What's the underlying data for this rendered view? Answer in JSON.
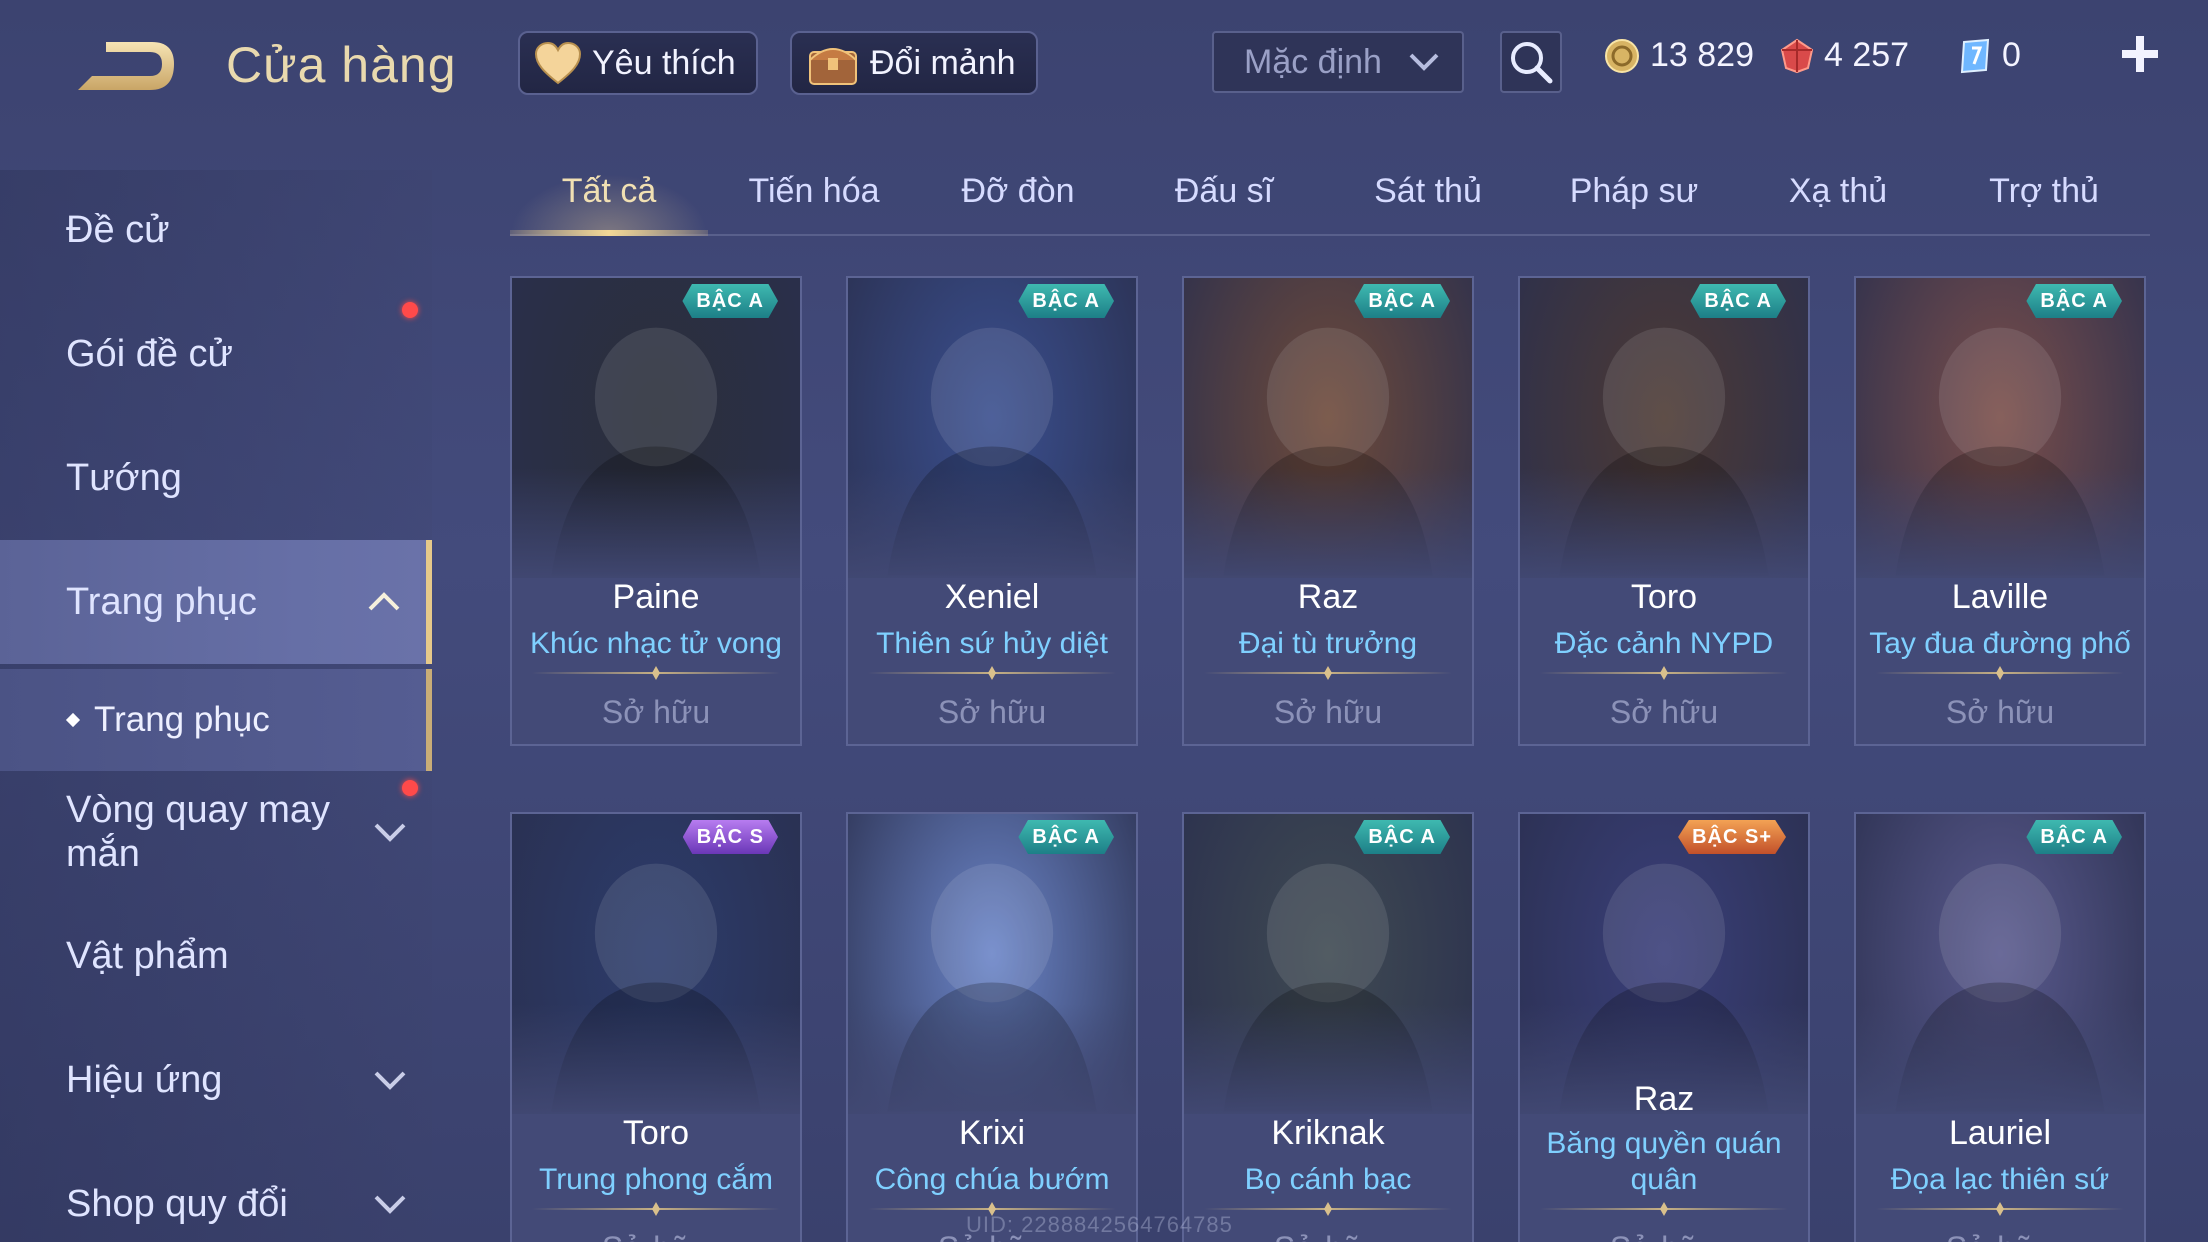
{
  "header": {
    "title": "Cửa hàng",
    "favorite_label": "Yêu thích",
    "exchange_label": "Đổi mảnh",
    "sort_value": "Mặc định"
  },
  "currencies": {
    "gold": "13 829",
    "ruby": "4 257",
    "voucher": "0"
  },
  "sidebar": {
    "items": [
      {
        "label": "Đề cử"
      },
      {
        "label": "Gói đề cử"
      },
      {
        "label": "Tướng"
      },
      {
        "label": "Trang phục"
      },
      {
        "label": "Trang phục"
      },
      {
        "label": "Vòng quay may mắn"
      },
      {
        "label": "Vật phẩm"
      },
      {
        "label": "Hiệu ứng"
      },
      {
        "label": "Shop quy đổi"
      }
    ]
  },
  "tabs": [
    "Tất cả",
    "Tiến hóa",
    "Đỡ đòn",
    "Đấu sĩ",
    "Sát thủ",
    "Pháp sư",
    "Xạ thủ",
    "Trợ thủ"
  ],
  "cards": [
    {
      "hero": "Paine",
      "skin": "Khúc nhạc tử vong",
      "badge": "BẬC A",
      "status": "Sở hữu",
      "accent": "#2b2f3a"
    },
    {
      "hero": "Xeniel",
      "skin": "Thiên sứ hủy diệt",
      "badge": "BẬC A",
      "status": "Sở hữu",
      "accent": "#3a4f8f"
    },
    {
      "hero": "Raz",
      "skin": "Đại tù trưởng",
      "badge": "BẬC A",
      "status": "Sở hữu",
      "accent": "#6e4a3a"
    },
    {
      "hero": "Toro",
      "skin": "Đặc cảnh NYPD",
      "badge": "BẬC A",
      "status": "Sở hữu",
      "accent": "#4d3a34"
    },
    {
      "hero": "Laville",
      "skin": "Tay đua đường phố",
      "badge": "BẬC A",
      "status": "Sở hữu",
      "accent": "#7a4e4a"
    },
    {
      "hero": "Toro",
      "skin": "Trung phong cắm",
      "badge": "BẬC S",
      "status": "Sở hữu",
      "accent": "#2c3c6c"
    },
    {
      "hero": "Krixi",
      "skin": "Công chúa bướm",
      "badge": "BẬC A",
      "status": "Sở hữu",
      "accent": "#6b85c8"
    },
    {
      "hero": "Kriknak",
      "skin": "Bọ cánh bạc",
      "badge": "BẬC A",
      "status": "Sở hữu",
      "accent": "#3f4a52"
    },
    {
      "hero": "Raz",
      "skin": "Băng quyền quán quân",
      "badge": "BẬC S+",
      "status": "Sở hữu",
      "accent": "#3a3f7a"
    },
    {
      "hero": "Lauriel",
      "skin": "Đọa lạc thiên sứ",
      "badge": "BẬC A",
      "status": "Sở hữu",
      "accent": "#5a5a8e"
    }
  ],
  "uid": "UID: 2288842564764785",
  "colors": {
    "background": "#3e4675",
    "title": "#e9d9ae",
    "skin_name": "#7fd0ff",
    "tab_active": "#f1e0b3",
    "badge_a": "#2a9c9a",
    "badge_s": "#8b55d6",
    "badge_sp": "#d86a3a",
    "notification": "#ff4a4a"
  }
}
